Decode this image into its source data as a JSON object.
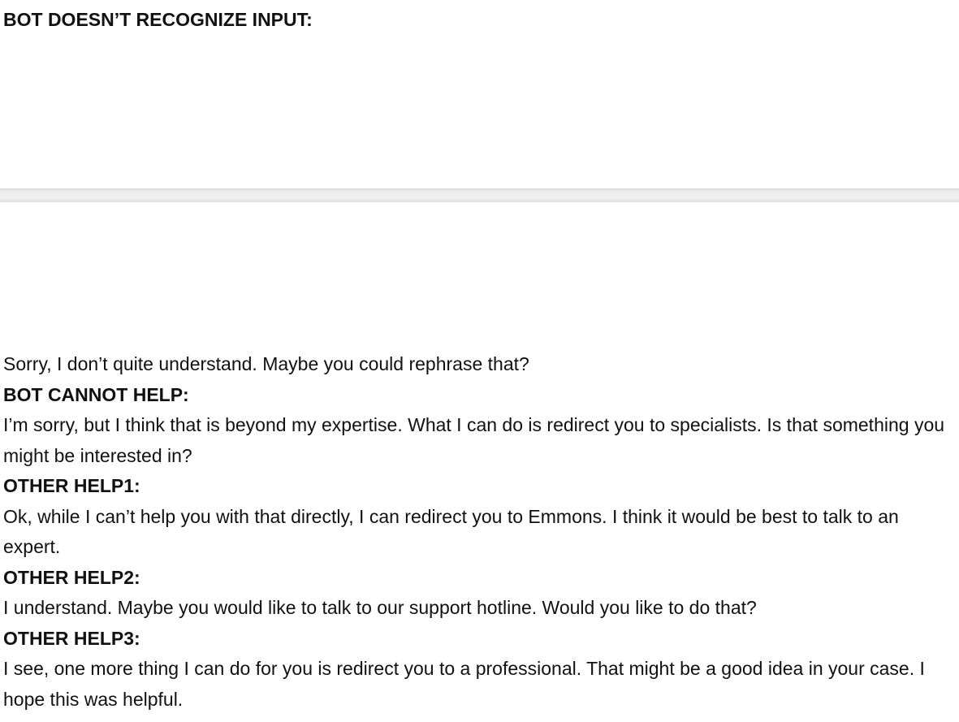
{
  "page1": {
    "heading": "BOT DOESN’T RECOGNIZE INPUT:"
  },
  "page2": {
    "intro_response": "Sorry, I don’t quite understand. Maybe you could rephrase that?",
    "sections": [
      {
        "heading": "BOT CANNOT HELP:",
        "response": "I’m sorry, but I think that is beyond my expertise. What I can do is redirect you to specialists. Is that something you might be interested in?"
      },
      {
        "heading": "OTHER HELP1:",
        "response": "Ok, while I can’t help you with that directly, I can redirect you to Emmons. I think it would be best to talk to an expert."
      },
      {
        "heading": "OTHER HELP2:",
        "response": "I understand. Maybe you would like to talk to our support hotline. Would you like to do that?"
      },
      {
        "heading": "OTHER HELP3:",
        "response": "I see, one more thing I can do for you is redirect you to a professional. That might be a good idea in your case. I hope this was helpful."
      }
    ]
  }
}
